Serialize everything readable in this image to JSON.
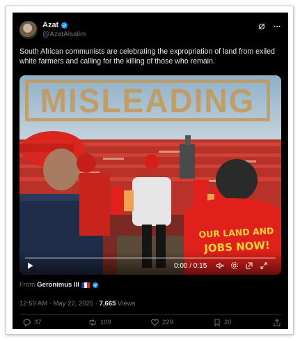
{
  "post": {
    "author": {
      "display_name": "Azat",
      "handle": "@AzatAlsalim",
      "verified": true
    },
    "text": "South African communists are celebrating the expropriation of land from exiled white farmers and calling for the killing of those who remain.",
    "media": {
      "overlay_stamp": "MISLEADING",
      "shirt_text_line1": "OUR LAND AND",
      "shirt_text_line2": "JOBS NOW!",
      "time": "0:00 / 0:15",
      "progress": 0
    },
    "attribution": {
      "prefix": "From",
      "source": "Geronimus III",
      "flag": "french-flag"
    },
    "meta": {
      "timestamp": "12:59 AM · May 22, 2025",
      "separator": "·",
      "views_count": "7,665",
      "views_label": "Views"
    },
    "actions": {
      "replies": "37",
      "reposts": "109",
      "likes": "229",
      "bookmarks": "20"
    }
  },
  "colors": {
    "background": "#000000",
    "text_primary": "#e7e9ea",
    "text_secondary": "#71767b",
    "verified": "#1d9bf0",
    "stamp": "#c69650",
    "shirt_red": "#e0201b",
    "shirt_text": "#f2d23b"
  },
  "icons": [
    "verified-badge-icon",
    "grok-icon",
    "more-icon",
    "play-icon",
    "volume-icon",
    "settings-icon",
    "pip-icon",
    "fullscreen-icon",
    "reply-icon",
    "repost-icon",
    "like-icon",
    "bookmark-icon",
    "share-icon"
  ]
}
